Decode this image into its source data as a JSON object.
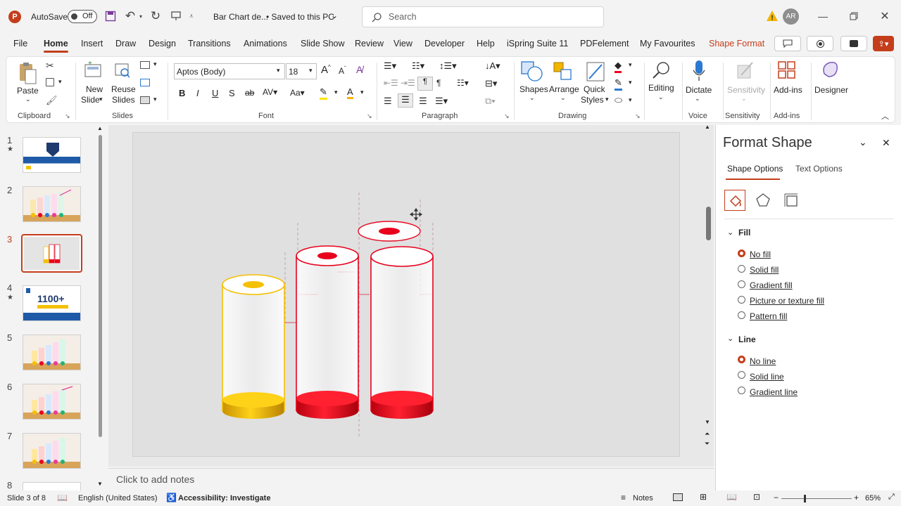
{
  "titlebar": {
    "autosave_label": "AutoSave",
    "autosave_state": "Off",
    "doc_title": "Bar Chart de...",
    "saved_state": "• Saved to this PC",
    "search_placeholder": "Search",
    "user_initials": "AR"
  },
  "menu": {
    "items": [
      "File",
      "Home",
      "Insert",
      "Draw",
      "Design",
      "Transitions",
      "Animations",
      "Slide Show",
      "Review",
      "View",
      "Developer",
      "Help",
      "iSpring Suite 11",
      "PDFelement",
      "My Favourites",
      "Shape Format"
    ],
    "active": "Home",
    "contextual": "Shape Format"
  },
  "ribbon": {
    "clipboard": {
      "paste": "Paste",
      "group": "Clipboard"
    },
    "slides": {
      "new_slide_1": "New",
      "new_slide_2": "Slide",
      "reuse_1": "Reuse",
      "reuse_2": "Slides",
      "group": "Slides"
    },
    "font": {
      "family": "Aptos (Body)",
      "size": "18",
      "group": "Font"
    },
    "paragraph": {
      "group": "Paragraph"
    },
    "drawing": {
      "shapes": "Shapes",
      "arrange": "Arrange",
      "quick_1": "Quick",
      "quick_2": "Styles",
      "group": "Drawing"
    },
    "editing": {
      "label": "Editing"
    },
    "voice": {
      "dictate": "Dictate",
      "group": "Voice"
    },
    "sensitivity": {
      "label": "Sensitivity",
      "group": "Sensitivity"
    },
    "addins": {
      "label": "Add-ins",
      "group": "Add-ins"
    },
    "designer": {
      "label": "Designer"
    }
  },
  "slides_panel": {
    "numbers": [
      "1",
      "2",
      "3",
      "4",
      "5",
      "6",
      "7",
      "8"
    ],
    "current": 3,
    "thumb4_text": "1100+"
  },
  "notes_placeholder": "Click to add notes",
  "format_pane": {
    "title": "Format Shape",
    "tabs": [
      "Shape Options",
      "Text Options"
    ],
    "fill_header": "Fill",
    "fill_options": [
      "No fill",
      "Solid fill",
      "Gradient fill",
      "Picture or texture fill",
      "Pattern fill"
    ],
    "fill_selected": "No fill",
    "line_header": "Line",
    "line_options": [
      "No line",
      "Solid line",
      "Gradient line"
    ],
    "line_selected": "No line"
  },
  "status": {
    "slide_info": "Slide 3 of 8",
    "language": "English (United States)",
    "accessibility": "Accessibility: Investigate",
    "notes": "Notes",
    "zoom": "65%"
  },
  "colors": {
    "accent": "#c43e1c",
    "yellow": "#f5c000",
    "red": "#e8001c"
  }
}
